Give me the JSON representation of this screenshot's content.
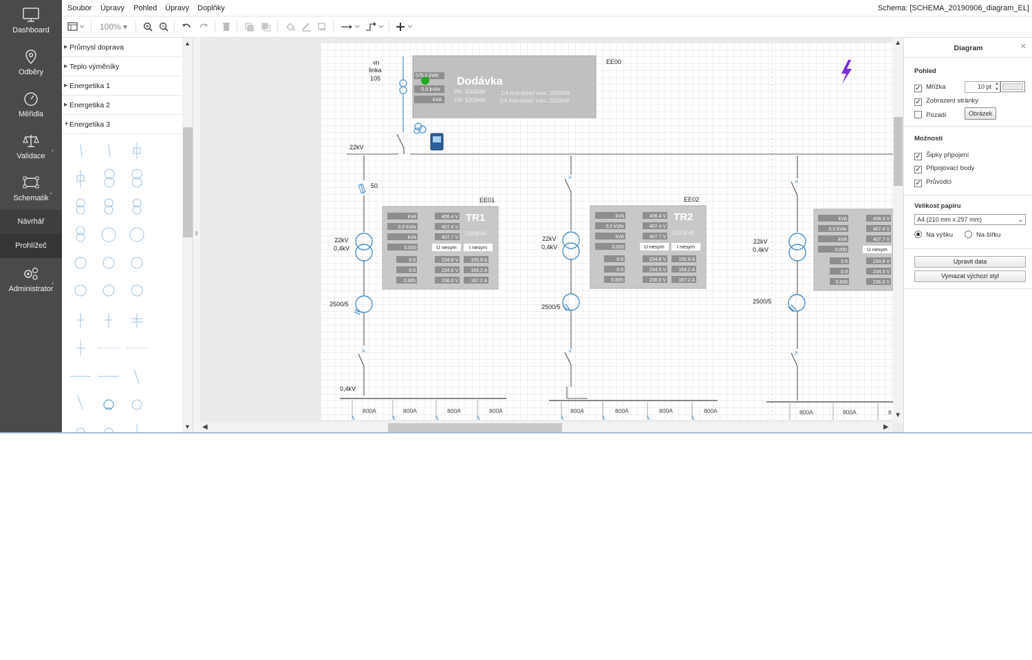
{
  "window": {
    "schema_title": "Schema: [SCHEMA_20190906_diagram_EL]"
  },
  "nav": [
    {
      "label": "Dashboard",
      "icon": "monitor-icon"
    },
    {
      "label": "Odběry",
      "icon": "location-pin-icon"
    },
    {
      "label": "Měřidla",
      "icon": "gauge-icon"
    },
    {
      "label": "Validace",
      "icon": "scales-icon"
    },
    {
      "label": "Schematik",
      "icon": "diagram-icon"
    },
    {
      "label": "Návrhář"
    },
    {
      "label": "Prohlížeč"
    },
    {
      "label": "Administrator",
      "icon": "gears-icon"
    }
  ],
  "menubar": [
    "Soubor",
    "Úpravy",
    "Pohled",
    "Úpravy",
    "Doplňky"
  ],
  "toolbar": {
    "zoom": "100%"
  },
  "palette": {
    "categories": [
      "Průmysl doprava",
      "Teplo výměníky",
      "Energetika 1",
      "Energetika 2",
      "Energetika 3"
    ]
  },
  "diagram": {
    "feed_label": [
      "vn",
      "linka",
      "105"
    ],
    "supply": {
      "title": "Dodávka",
      "kwh": "575.0 kWh",
      "kvar": "0.0 kVAr",
      "kva": "kVA",
      "rk": "RK: 3500kW",
      "tm": "TM: 5200kW",
      "day_max": "1/4 hod denní max. 2500kW",
      "month_max": "1/4 hod měsíc  max. 2500kW",
      "code": "EE00"
    },
    "bus_voltage": "22kV",
    "fuse_label": "50",
    "lv_label": "0,4kV",
    "ct_label": "2500/5",
    "feeder_label": "800A",
    "transformers": [
      {
        "code": "EE01",
        "name": "TR1",
        "rating": "1000kVA",
        "volts": [
          "406.4 V",
          "407.4 V",
          "407.7 V"
        ],
        "phase_volts": [
          "234.8 V",
          "234.5 V",
          "236.0 V"
        ],
        "amps": [
          "155.9 A",
          "164.2 A",
          "167.2 A"
        ],
        "pf": [
          "0.9",
          "0.9",
          "0.865"
        ],
        "kva": "kVA",
        "kvar": "0.0 kVAr",
        "zero": "0.000",
        "u_nesym": "U nesym",
        "i_nesym": "I nesym",
        "ratio": [
          "22kV",
          "0,4kV"
        ]
      },
      {
        "code": "EE02",
        "name": "TR2",
        "rating": "1000kVA",
        "volts": [
          "406.4 V",
          "407.4 V",
          "407.7 V"
        ],
        "phase_volts": [
          "234.8 V",
          "234.5 V",
          "236.0 V"
        ],
        "amps": [
          "155.9 A",
          "164.2 A",
          "167.2 A"
        ],
        "pf": [
          "0.9",
          "0.9",
          "0.865"
        ],
        "kva": "kVA",
        "kvar": "0.0 kVAr",
        "zero": "0.000",
        "u_nesym": "U nesym",
        "i_nesym": "I nesym",
        "ratio": [
          "22kV",
          "0,4kV"
        ]
      },
      {
        "code": "",
        "name": "",
        "rating": "",
        "volts": [
          "406.4 V",
          "407.4 V",
          "407.7 V"
        ],
        "phase_volts": [
          "234.8 V",
          "234.5 V",
          "236.0 V"
        ],
        "amps": [],
        "pf": [
          "0.9",
          "0.9",
          "0.865"
        ],
        "kva": "kVA",
        "kvar": "0.0 kVAr",
        "zero": "0.000",
        "u_nesym": "U nesym",
        "i_nesym": "",
        "ratio": [
          "22kV",
          "0,4kV"
        ]
      }
    ],
    "colors": {
      "symbol": "#4a90c8",
      "box": "#c8c8c8",
      "supply_box": "#c0c0c0",
      "bolt": "#7b2bd6",
      "ok_led": "#22aa22"
    }
  },
  "right_panel": {
    "title": "Diagram",
    "view_section": "Pohled",
    "grid_label": "Mřížka",
    "grid_size": "10 pt",
    "page_view_label": "Zobrazení stránky",
    "background_label": "Pozadí",
    "image_button": "Obrázek",
    "options_section": "Možnosti",
    "arrows_label": "Šipky připojení",
    "points_label": "Připojovací body",
    "guides_label": "Průvodci",
    "paper_section": "Velikost papíru",
    "paper_size": "A4 (210 mm x 297 mm)",
    "portrait_label": "Na výšku",
    "landscape_label": "Na šířku",
    "edit_data_button": "Upravit data",
    "clear_style_button": "Vymazat výchozí styl",
    "checked": {
      "grid": true,
      "page_view": true,
      "background": false,
      "arrows": true,
      "points": true,
      "guides": true
    },
    "orientation": "portrait"
  }
}
